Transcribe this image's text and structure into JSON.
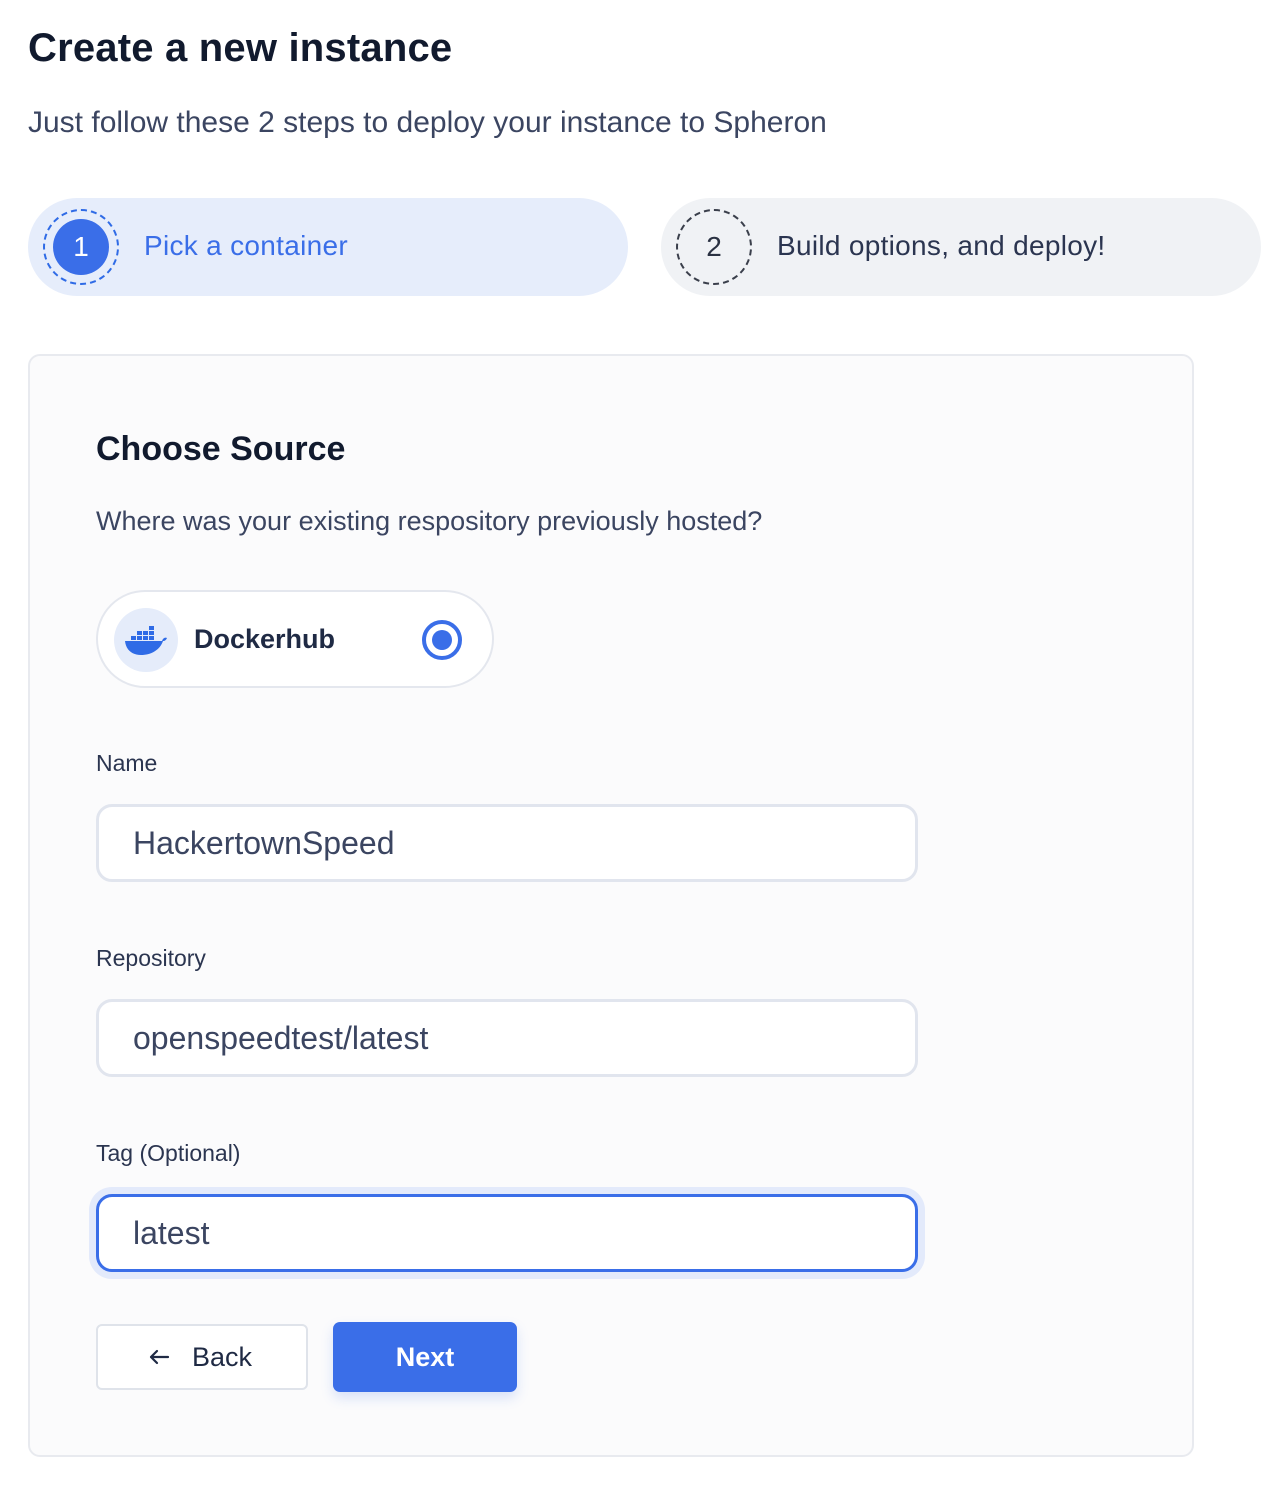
{
  "header": {
    "title": "Create a new instance",
    "subtitle": "Just follow these 2 steps to deploy your instance to Spheron"
  },
  "steps": [
    {
      "number": "1",
      "label": "Pick a container",
      "state": "active"
    },
    {
      "number": "2",
      "label": "Build options, and deploy!",
      "state": "inactive"
    }
  ],
  "source": {
    "title": "Choose Source",
    "description": "Where was your existing respository previously hosted?",
    "option": {
      "label": "Dockerhub",
      "icon": "docker-icon",
      "selected": true
    }
  },
  "form": {
    "name": {
      "label": "Name",
      "value": "HackertownSpeed"
    },
    "repository": {
      "label": "Repository",
      "value": "openspeedtest/latest"
    },
    "tag": {
      "label": "Tag (Optional)",
      "value": "latest",
      "focused": true
    }
  },
  "actions": {
    "back_label": "Back",
    "next_label": "Next"
  },
  "colors": {
    "accent": "#3a6ee8",
    "active_step_bg": "#e6edfb",
    "inactive_step_bg": "#f0f2f5"
  }
}
